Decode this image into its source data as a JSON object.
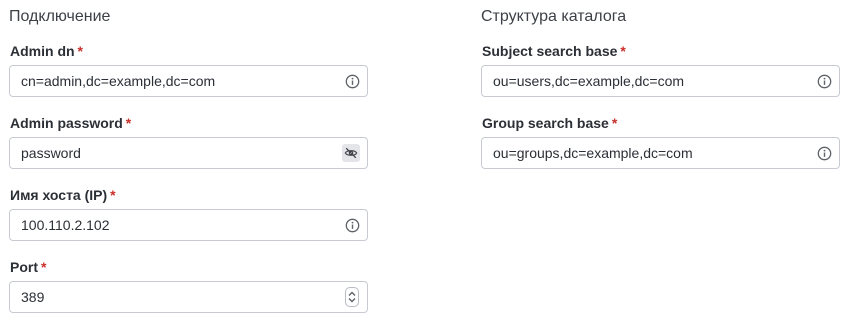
{
  "connection": {
    "title": "Подключение",
    "fields": [
      {
        "label": "Admin dn",
        "value": "cn=admin,dc=example,dc=com",
        "trailing_icon": "info-icon"
      },
      {
        "label": "Admin password",
        "value": "password",
        "trailing_icon": "eye-off-icon"
      },
      {
        "label": "Имя хоста (IP)",
        "value": "100.110.2.102",
        "trailing_icon": "info-icon"
      },
      {
        "label": "Port",
        "value": "389",
        "trailing_icon": "stepper-icon"
      }
    ]
  },
  "directory": {
    "title": "Структура каталога",
    "fields": [
      {
        "label": "Subject search base",
        "value": "ou=users,dc=example,dc=com",
        "trailing_icon": "info-icon"
      },
      {
        "label": "Group search base",
        "value": "ou=groups,dc=example,dc=com",
        "trailing_icon": "info-icon"
      }
    ]
  },
  "required_marker": "*",
  "colors": {
    "required": "#c9302c",
    "border": "#c7cbd1",
    "icon": "#5f6368"
  }
}
